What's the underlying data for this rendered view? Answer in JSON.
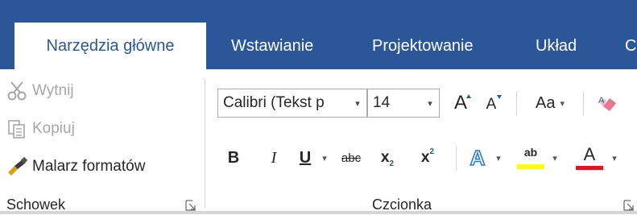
{
  "tabs": [
    {
      "label": "Narzędzia główne",
      "active": true
    },
    {
      "label": "Wstawianie",
      "active": false
    },
    {
      "label": "Projektowanie",
      "active": false
    },
    {
      "label": "Układ",
      "active": false
    },
    {
      "label": "C",
      "active": false
    }
  ],
  "clipboard": {
    "cut_label": "Wytnij",
    "copy_label": "Kopiuj",
    "format_painter_label": "Malarz formatów",
    "group_label": "Schowek"
  },
  "font": {
    "font_name": "Calibri (Tekst p",
    "font_size": "14",
    "grow_label": "A",
    "shrink_label": "A",
    "change_case_label": "Aa",
    "bold_label": "B",
    "italic_label": "I",
    "underline_label": "U",
    "strike_label": "abc",
    "subscript_label": "x",
    "subscript_mark": "2",
    "superscript_label": "x",
    "superscript_mark": "2",
    "text_effects_label": "A",
    "highlight_label": "ab",
    "font_color_label": "A",
    "group_label": "Czcionka"
  },
  "colors": {
    "ribbon_blue": "#2b579a",
    "highlight": "#ffff00",
    "font_color": "#e81123"
  }
}
